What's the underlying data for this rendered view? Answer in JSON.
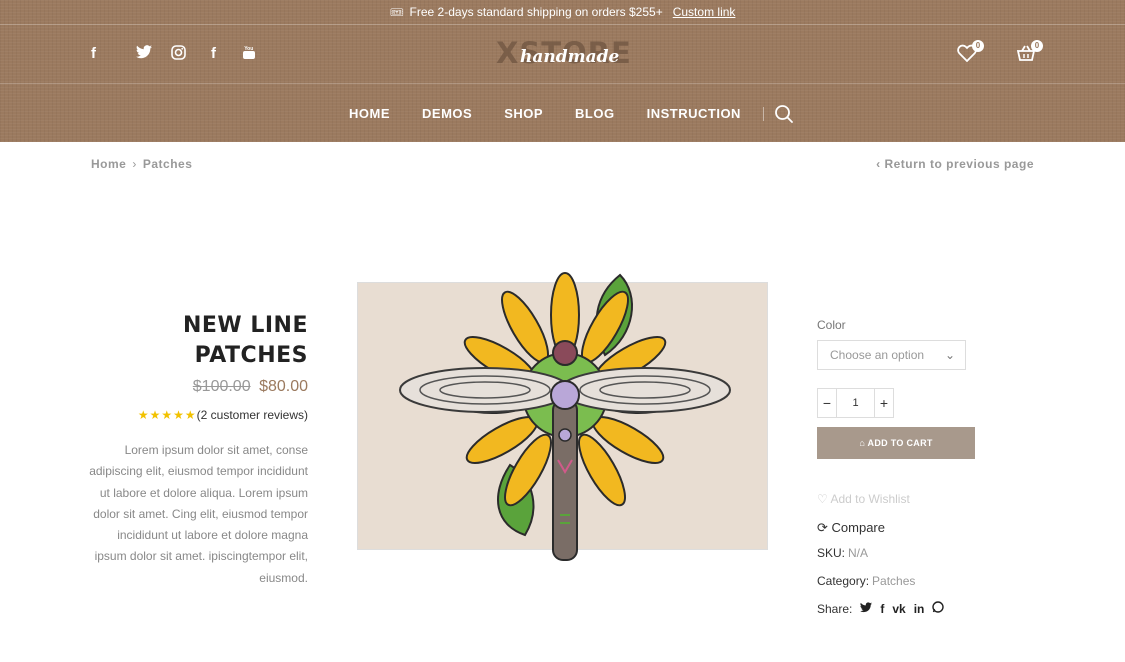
{
  "topbar": {
    "text": "Free 2-days standard shipping on orders $255+",
    "link": "Custom link"
  },
  "logo": {
    "big": "XSTORE",
    "script": "handmade"
  },
  "socials": [
    "facebook-icon",
    "twitter-icon",
    "instagram-icon",
    "facebook-icon",
    "youtube-icon"
  ],
  "header_icons": {
    "wishlist_count": "0",
    "cart_count": "0"
  },
  "nav": {
    "items": [
      "HOME",
      "DEMOS",
      "SHOP",
      "BLOG",
      "INSTRUCTION"
    ]
  },
  "breadcrumb": {
    "home": "Home",
    "current": "Patches",
    "return": "Return to previous page"
  },
  "product": {
    "title_line1": "NEW LINE",
    "title_line2": "PATCHES",
    "old_price": "$100.00",
    "price": "$80.00",
    "rating": 5,
    "stars": "★★★★★",
    "reviews": "(2 customer reviews)",
    "description": "Lorem ipsum dolor sit amet, conse adipiscing elit, eiusmod tempor incididunt ut labore et dolore aliqua. Lorem ipsum dolor sit amet. Cing elit, eiusmod tempor incididunt ut labore et dolore magna ipsum dolor sit amet. ipiscingtempor elit, eiusmod."
  },
  "options": {
    "color_label": "Color",
    "select_placeholder": "Choose an option",
    "quantity": "1",
    "add_to_cart": "ADD TO CART",
    "wishlist": "Add to Wishlist",
    "compare": "Compare",
    "sku_label": "SKU:",
    "sku_value": "N/A",
    "category_label": "Category:",
    "category_value": "Patches",
    "share_label": "Share:"
  },
  "colors": {
    "brand": "#9b7a5f",
    "button": "#a8998c",
    "star": "#f2c200"
  }
}
